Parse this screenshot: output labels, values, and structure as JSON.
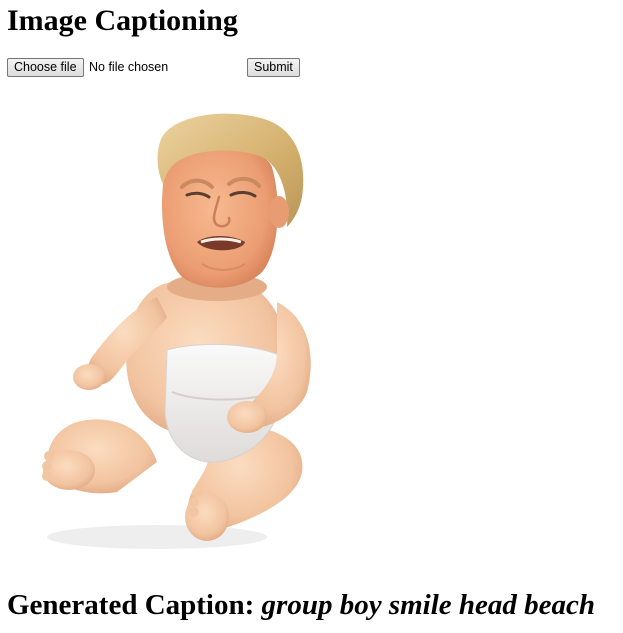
{
  "page": {
    "title": "Image Captioning"
  },
  "upload_form": {
    "choose_file_label": "Choose file",
    "file_status": "No file chosen",
    "submit_label": "Submit"
  },
  "caption": {
    "label": "Generated Caption:",
    "text": "group boy smile head beach"
  },
  "colors": {
    "skin": "#f2c7a4",
    "face": "#f0a77e",
    "hair": "#d9b978",
    "diaper": "#f2f0ee"
  }
}
